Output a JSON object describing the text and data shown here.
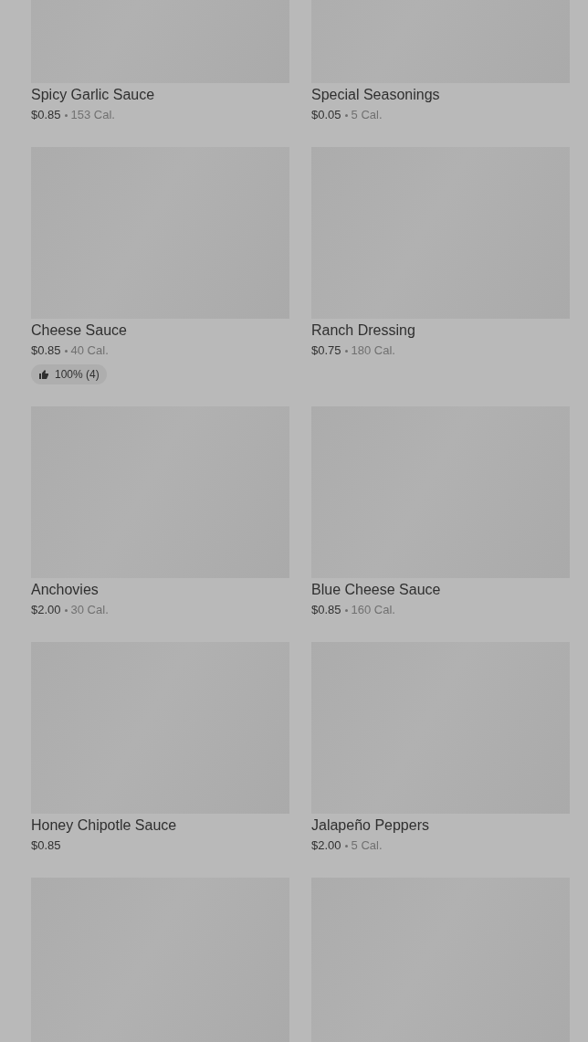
{
  "items": [
    {
      "kind": "item",
      "name": "Spicy Garlic Sauce",
      "price": "$0.85",
      "calories": "153 Cal."
    },
    {
      "kind": "item",
      "name": "Special Seasonings",
      "price": "$0.05",
      "calories": "5 Cal."
    },
    {
      "kind": "item",
      "name": "Cheese Sauce",
      "price": "$0.85",
      "calories": "40 Cal.",
      "rating": "100% (4)"
    },
    {
      "kind": "item",
      "name": "Ranch Dressing",
      "price": "$0.75",
      "calories": "180 Cal."
    },
    {
      "kind": "item",
      "name": "Anchovies",
      "price": "$2.00",
      "calories": "30 Cal."
    },
    {
      "kind": "item",
      "name": "Blue Cheese Sauce",
      "price": "$0.85",
      "calories": "160 Cal."
    },
    {
      "kind": "item",
      "name": "Honey Chipotle Sauce",
      "price": "$0.85"
    },
    {
      "kind": "item",
      "name": "Jalapeño Peppers",
      "price": "$2.00",
      "calories": "5 Cal."
    },
    {
      "kind": "image-only"
    },
    {
      "kind": "image-only"
    }
  ]
}
